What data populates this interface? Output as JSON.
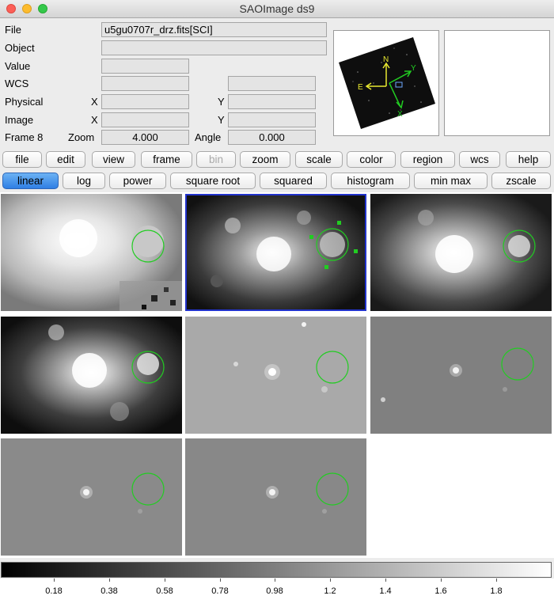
{
  "window": {
    "title": "SAOImage ds9"
  },
  "info": {
    "file_label": "File",
    "file_value": "u5gu0707r_drz.fits[SCI]",
    "object_label": "Object",
    "object_value": "",
    "value_label": "Value",
    "value_value": "",
    "wcs_label": "WCS",
    "wcs_value": "",
    "wcs_value2": "",
    "physical_label": "Physical",
    "physical_x_label": "X",
    "physical_x": "",
    "physical_y_label": "Y",
    "physical_y": "",
    "image_label": "Image",
    "image_x_label": "X",
    "image_x": "",
    "image_y_label": "Y",
    "image_y": "",
    "frame_label": "Frame 8",
    "zoom_label": "Zoom",
    "zoom_value": "4.000",
    "angle_label": "Angle",
    "angle_value": "0.000"
  },
  "panner": {
    "n_label": "N",
    "e_label": "E",
    "x_label": "X",
    "y_label": "Y"
  },
  "menu_buttons": [
    "file",
    "edit",
    "view",
    "frame",
    "bin",
    "zoom",
    "scale",
    "color",
    "region",
    "wcs",
    "help"
  ],
  "scale_buttons": [
    "linear",
    "log",
    "power",
    "square root",
    "squared",
    "histogram",
    "min max",
    "zscale"
  ],
  "active_scale": "linear",
  "disabled_menu": "bin",
  "colorbar": {
    "tick_labels": [
      "0.18",
      "0.38",
      "0.58",
      "0.78",
      "0.98",
      "1.2",
      "1.4",
      "1.6",
      "1.8"
    ]
  },
  "colors": {
    "region": "#22cc22",
    "selection": "#2233cc",
    "active_button": "#3f8ff0"
  }
}
